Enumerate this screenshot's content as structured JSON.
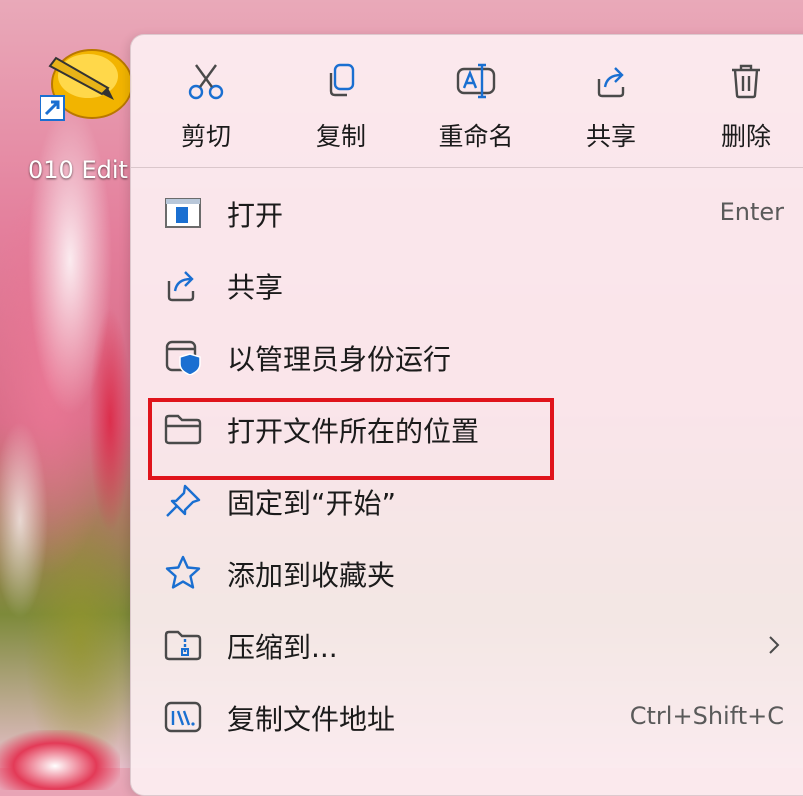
{
  "desktop_icon": {
    "label": "010 Edit",
    "icon": "010-editor-app-icon"
  },
  "quick_actions": [
    {
      "name": "cut",
      "label": "剪切",
      "icon": "scissors-icon"
    },
    {
      "name": "copy",
      "label": "复制",
      "icon": "copy-icon"
    },
    {
      "name": "rename",
      "label": "重命名",
      "icon": "rename-icon"
    },
    {
      "name": "share",
      "label": "共享",
      "icon": "share-icon"
    },
    {
      "name": "delete",
      "label": "删除",
      "icon": "trash-icon"
    }
  ],
  "menu_items": [
    {
      "name": "open",
      "label": "打开",
      "shortcut": "Enter",
      "icon": "app-window-icon"
    },
    {
      "name": "share",
      "label": "共享",
      "shortcut": "",
      "icon": "share-icon"
    },
    {
      "name": "run-as-admin",
      "label": "以管理员身份运行",
      "shortcut": "",
      "icon": "admin-shield-icon"
    },
    {
      "name": "open-file-location",
      "label": "打开文件所在的位置",
      "shortcut": "",
      "icon": "folder-icon",
      "highlighted": true
    },
    {
      "name": "pin-to-start",
      "label": "固定到“开始”",
      "shortcut": "",
      "icon": "pin-icon"
    },
    {
      "name": "add-to-favorites",
      "label": "添加到收藏夹",
      "shortcut": "",
      "icon": "star-icon"
    },
    {
      "name": "compress-to",
      "label": "压缩到...",
      "shortcut": "",
      "icon": "zip-folder-icon",
      "submenu": true
    },
    {
      "name": "copy-as-path",
      "label": "复制文件地址",
      "shortcut": "Ctrl+Shift+C",
      "icon": "copy-path-icon"
    }
  ],
  "colors": {
    "highlight_border": "#e0131b",
    "icon_blue": "#1a6fd1",
    "icon_gray": "#4a4a4a"
  }
}
